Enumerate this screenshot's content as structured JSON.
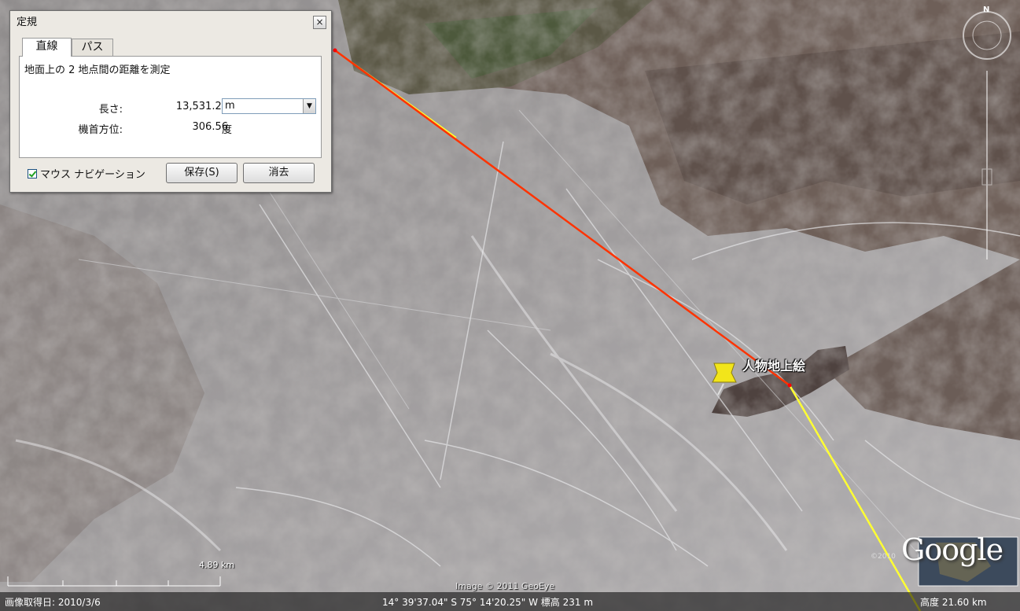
{
  "dialog": {
    "title": "定規",
    "close_symbol": "×",
    "tabs": [
      {
        "label": "直線",
        "active": true
      },
      {
        "label": "パス",
        "active": false
      }
    ],
    "description": "地面上の 2 地点間の距離を測定",
    "length": {
      "label": "長さ:",
      "value": "13,531.20",
      "unit": "m"
    },
    "heading": {
      "label": "機首方位:",
      "value": "306.56",
      "unit": "度"
    },
    "mouse_navigation": {
      "label": "マウス ナビゲーション",
      "checked": true
    },
    "save_button": "保存(S)",
    "clear_button": "消去"
  },
  "map": {
    "placemark_label": "人物地上絵",
    "scale_label": "4.89 km",
    "imagery_credit": "Image © 2011 GeoEye",
    "year_credit": "©2010",
    "logo_text": "Google",
    "compass_north": "N",
    "ruler_line_color": "#ff3300",
    "path_line_color": "#ffff33",
    "placemark_color": "#f2e51a"
  },
  "statusbar": {
    "imagery_date": "画像取得日: 2010/3/6",
    "coordinates": "14° 39'37.04\" S  75° 14'20.25\" W  標高  231 m",
    "altitude": "高度   21.60 km"
  }
}
